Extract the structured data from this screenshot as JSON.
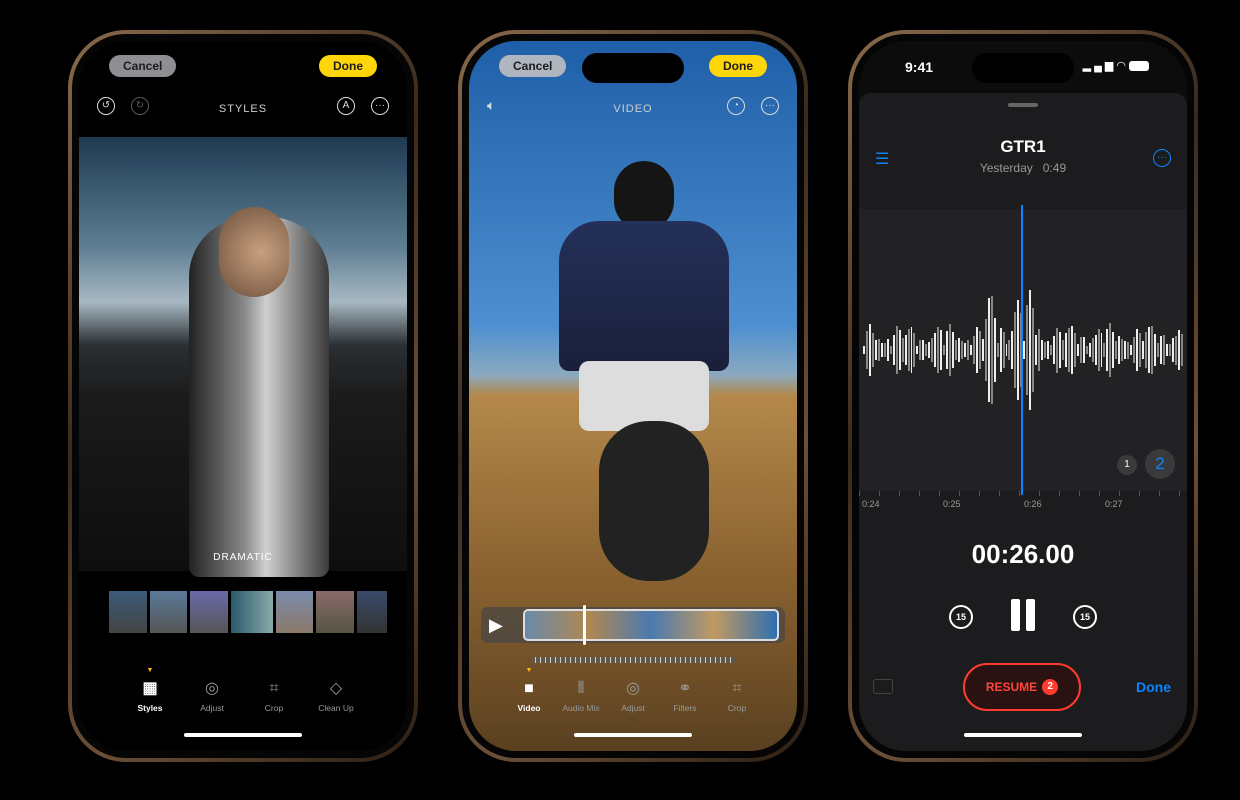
{
  "styles_editor": {
    "cancel": "Cancel",
    "done": "Done",
    "title": "STYLES",
    "style_name": "DRAMATIC",
    "icons": [
      "undo-icon",
      "redo-icon",
      "markup-icon",
      "more-icon"
    ],
    "tabs": [
      {
        "label": "Styles",
        "icon": "styles-grid-icon",
        "active": true
      },
      {
        "label": "Adjust",
        "icon": "adjust-dial-icon"
      },
      {
        "label": "Crop",
        "icon": "crop-icon"
      },
      {
        "label": "Clean Up",
        "icon": "eraser-icon"
      }
    ]
  },
  "video_editor": {
    "cancel": "Cancel",
    "done": "Done",
    "title": "VIDEO",
    "icons": [
      "speaker-icon",
      "speed-icon",
      "more-icon",
      "play-icon"
    ],
    "tabs": [
      {
        "label": "Video",
        "icon": "video-camera-icon",
        "active": true
      },
      {
        "label": "Audio Mix",
        "icon": "audio-mix-icon"
      },
      {
        "label": "Adjust",
        "icon": "adjust-dial-icon"
      },
      {
        "label": "Filters",
        "icon": "filters-icon"
      },
      {
        "label": "Crop",
        "icon": "crop-icon"
      }
    ]
  },
  "voice_memo": {
    "status_time": "9:41",
    "title": "GTR1",
    "date": "Yesterday",
    "duration": "0:49",
    "timeline_labels": [
      "0:24",
      "0:25",
      "0:26",
      "0:27"
    ],
    "layers": [
      "1",
      "2"
    ],
    "timer": "00:26.00",
    "skip_back": "15",
    "skip_forward": "15",
    "resume": "RESUME",
    "resume_badge": "2",
    "done": "Done",
    "accent": "#0a84ff",
    "record_red": "#ff3b30"
  }
}
